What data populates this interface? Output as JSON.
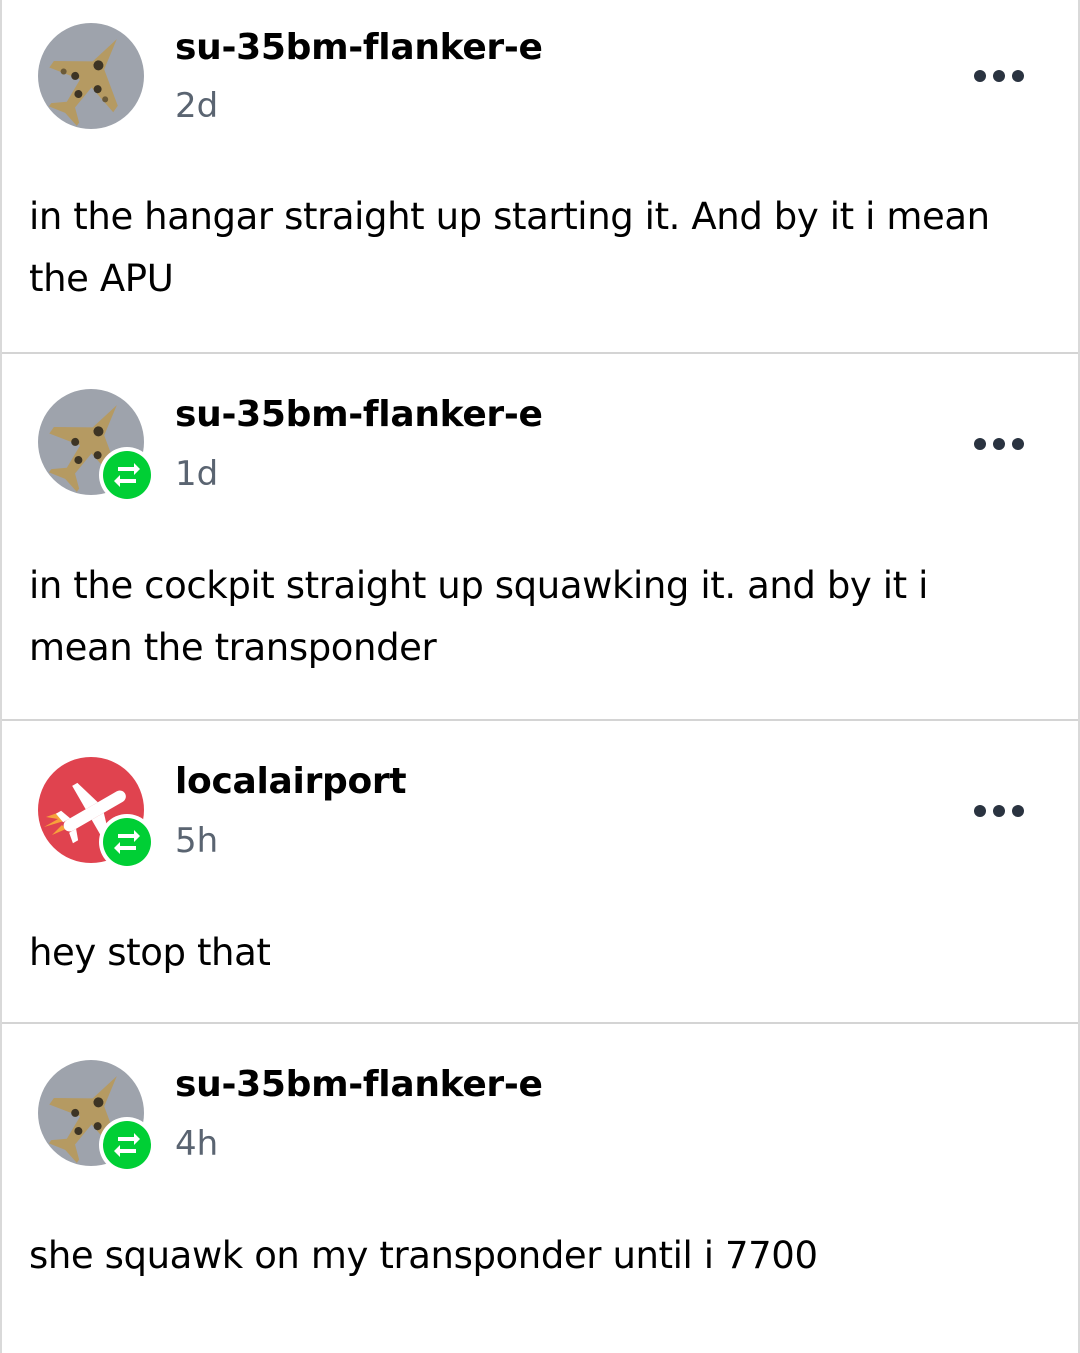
{
  "posts": [
    {
      "username": "su-35bm-flanker-e",
      "time": "2d",
      "text": "in the hangar straight up starting it. And by it i mean the APU",
      "avatar": "jet-camo-avatar",
      "reblogged": false
    },
    {
      "username": "su-35bm-flanker-e",
      "time": "1d",
      "text": "in the cockpit straight up squawking it. and by it i mean the transponder",
      "avatar": "jet-camo-avatar",
      "reblogged": true
    },
    {
      "username": "localairport",
      "time": "5h",
      "text": "hey stop that",
      "avatar": "airplane-logo-avatar",
      "reblogged": true
    },
    {
      "username": "su-35bm-flanker-e",
      "time": "4h",
      "text": "she squawk on my transponder until i 7700",
      "avatar": "jet-camo-avatar",
      "reblogged": true
    }
  ],
  "colors": {
    "reblog_green": "#00cf35",
    "timestamp_gray": "#5a6471",
    "airport_red": "#e0434f"
  },
  "icons": {
    "more": "more-dots-icon",
    "reblog": "reblog-icon"
  }
}
